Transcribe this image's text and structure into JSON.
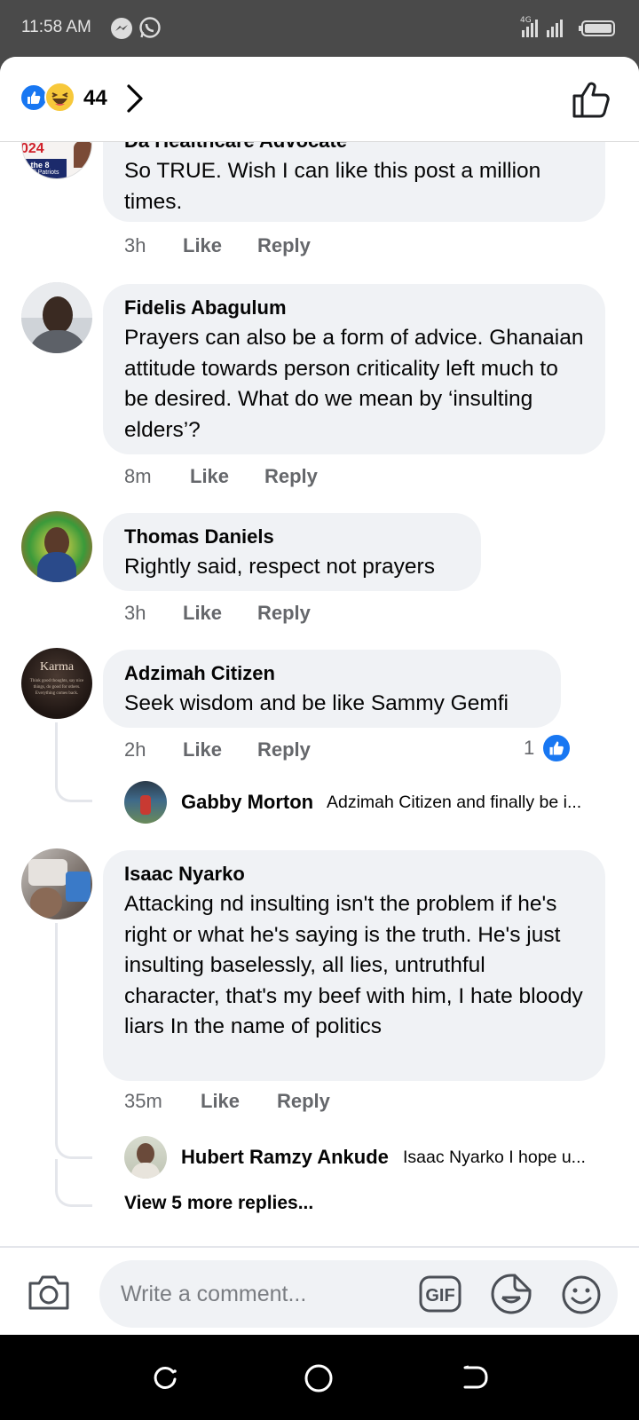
{
  "status_bar": {
    "time": "11:58 AM",
    "network": "4G"
  },
  "header": {
    "reaction_count": "44"
  },
  "comments": [
    {
      "author": "Da Healthcare Advocate",
      "avatar_text": [
        "024",
        "k the 8",
        "All Patriots"
      ],
      "text": "So TRUE. Wish I can like this post a million times.",
      "age": "3h",
      "like": "Like",
      "reply": "Reply"
    },
    {
      "author": "Fidelis Abagulum",
      "text": "Prayers can also be a form of advice. Ghanaian attitude towards person criticality left much to be desired. What do we mean by ‘insulting elders’?",
      "age": "8m",
      "like": "Like",
      "reply": "Reply"
    },
    {
      "author": "Thomas Daniels",
      "text": "Rightly said, respect not prayers",
      "age": "3h",
      "like": "Like",
      "reply": "Reply"
    },
    {
      "author": "Adzimah Citizen",
      "avatar_text": "Karma",
      "avatar_small_text": "Think good thoughts, say nice things, do good for others. Everything comes back.",
      "text": "Seek wisdom and be like Sammy Gemfi",
      "age": "2h",
      "like": "Like",
      "reply": "Reply",
      "reaction_count": "1",
      "reply_preview": {
        "author": "Gabby Morton",
        "text": "Adzimah Citizen and finally be i..."
      }
    },
    {
      "author": "Isaac Nyarko",
      "text": "Attacking nd insulting isn't the problem if he's right or what he's saying is the truth. He's just insulting baselessly, all lies, untruthful character, that's my beef with him, I hate bloody liars In the name of politics",
      "age": "35m",
      "like": "Like",
      "reply": "Reply",
      "reply_preview": {
        "author": "Hubert Ramzy Ankude",
        "text": "Isaac Nyarko I hope u..."
      },
      "view_more": "View 5 more replies..."
    }
  ],
  "composer": {
    "placeholder": "Write a comment...",
    "gif_label": "GIF"
  },
  "icons": {
    "status": [
      "messenger-icon",
      "whatsapp-icon",
      "signal-icon",
      "battery-icon"
    ],
    "header": [
      "like-reaction-icon",
      "haha-reaction-icon",
      "chevron-right-icon",
      "thumbs-up-outline-icon"
    ],
    "composer": [
      "camera-icon",
      "gif-icon",
      "sticker-icon",
      "emoji-icon"
    ],
    "nav": [
      "recents-icon",
      "home-icon",
      "back-icon"
    ]
  },
  "colors": {
    "accent": "#1877f2",
    "bubble": "#f0f2f5",
    "secondary_text": "#65676b"
  }
}
